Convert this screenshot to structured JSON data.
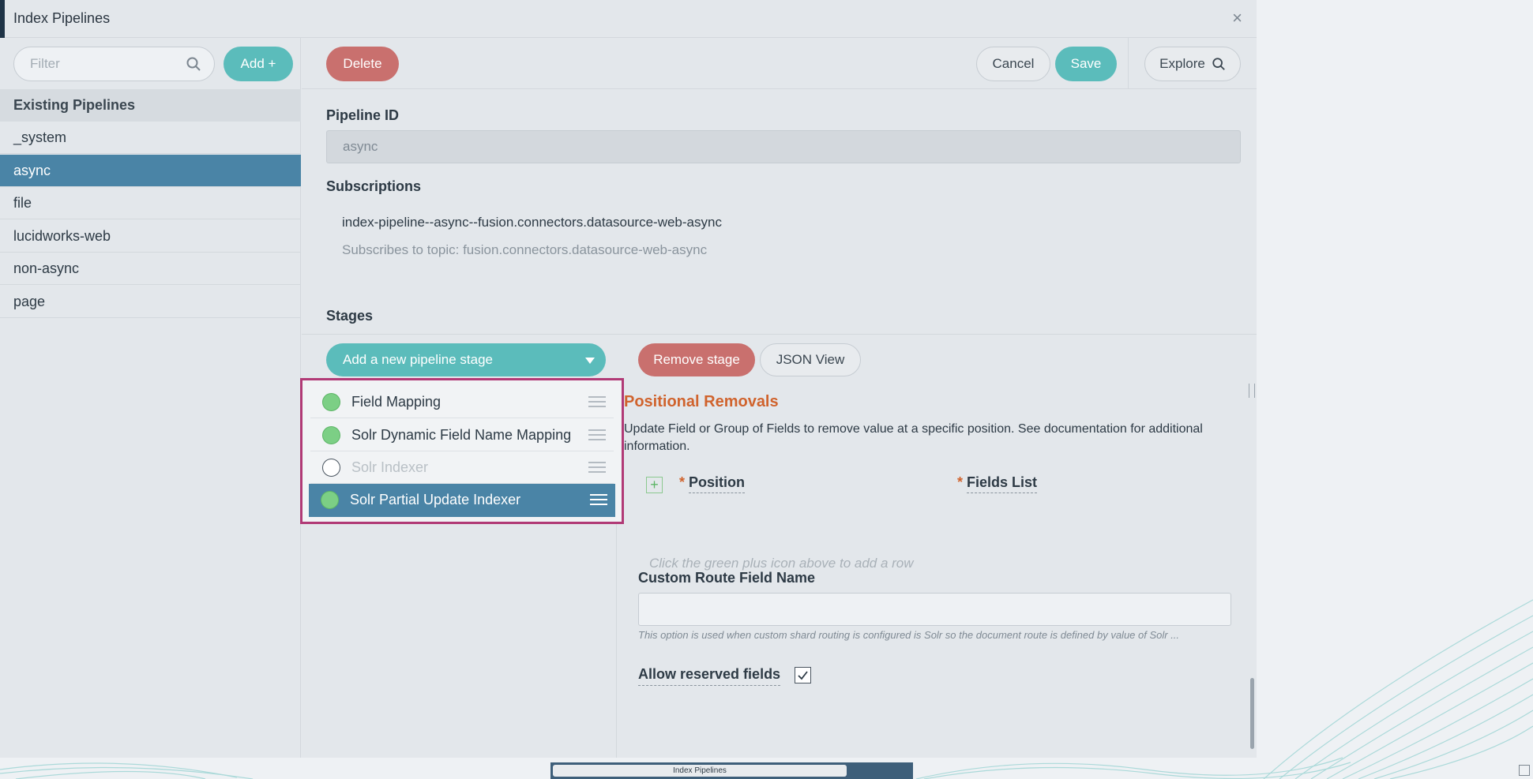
{
  "window": {
    "title": "Index Pipelines",
    "close_glyph": "×"
  },
  "sidebar": {
    "filter_placeholder": "Filter",
    "add_label": "Add +",
    "list_title": "Existing Pipelines",
    "items": [
      "_system",
      "async",
      "file",
      "lucidworks-web",
      "non-async",
      "page"
    ],
    "selected": "async"
  },
  "toolbar": {
    "delete_label": "Delete",
    "cancel_label": "Cancel",
    "save_label": "Save",
    "explore_label": "Explore"
  },
  "form": {
    "pipeline_id_label": "Pipeline ID",
    "pipeline_id_value": "async",
    "subscriptions_label": "Subscriptions",
    "subscription_name": "index-pipeline--async--fusion.connectors.datasource-web-async",
    "subscription_topic": "Subscribes to topic: fusion.connectors.datasource-web-async",
    "stages_label": "Stages"
  },
  "stages": {
    "add_label": "Add a new pipeline stage",
    "remove_label": "Remove stage",
    "json_label": "JSON View",
    "items": [
      {
        "name": "Field Mapping",
        "enabled": true,
        "selected": false
      },
      {
        "name": "Solr Dynamic Field Name Mapping",
        "enabled": true,
        "selected": false
      },
      {
        "name": "Solr Indexer",
        "enabled": false,
        "selected": false
      },
      {
        "name": "Solr Partial Update Indexer",
        "enabled": true,
        "selected": true
      }
    ]
  },
  "detail": {
    "title": "Positional Removals",
    "description": "Update Field or Group of Fields to remove value at a specific position. See documentation for additional information.",
    "required_mark": "*",
    "col_position": "Position",
    "col_fields": "Fields List",
    "empty_hint": "Click the green plus icon above to add a row",
    "route_label": "Custom Route Field Name",
    "route_value": "",
    "route_help": "This option is used when custom shard routing is configured is Solr so the document route is defined by value of Solr ...",
    "reserved_label": "Allow reserved fields",
    "reserved_checked": true
  },
  "taskbar": {
    "tab_label": "Index Pipelines"
  },
  "colors": {
    "accent_teal": "#5bbcbb",
    "danger": "#c9706e",
    "selected_blue": "#4a84a6",
    "title_orange": "#d0632d",
    "highlight_magenta": "#b13a76"
  }
}
